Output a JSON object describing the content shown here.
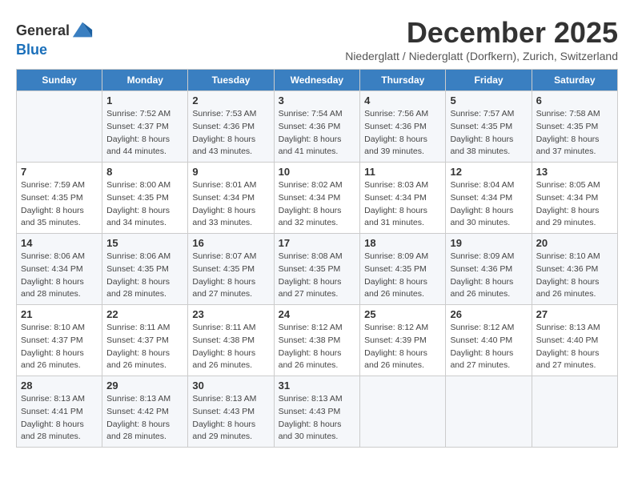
{
  "header": {
    "logo_general": "General",
    "logo_blue": "Blue",
    "title": "December 2025",
    "subtitle": "Niederglatt / Niederglatt (Dorfkern), Zurich, Switzerland"
  },
  "weekdays": [
    "Sunday",
    "Monday",
    "Tuesday",
    "Wednesday",
    "Thursday",
    "Friday",
    "Saturday"
  ],
  "weeks": [
    [
      {
        "day": "",
        "sunrise": "",
        "sunset": "",
        "daylight": ""
      },
      {
        "day": "1",
        "sunrise": "Sunrise: 7:52 AM",
        "sunset": "Sunset: 4:37 PM",
        "daylight": "Daylight: 8 hours and 44 minutes."
      },
      {
        "day": "2",
        "sunrise": "Sunrise: 7:53 AM",
        "sunset": "Sunset: 4:36 PM",
        "daylight": "Daylight: 8 hours and 43 minutes."
      },
      {
        "day": "3",
        "sunrise": "Sunrise: 7:54 AM",
        "sunset": "Sunset: 4:36 PM",
        "daylight": "Daylight: 8 hours and 41 minutes."
      },
      {
        "day": "4",
        "sunrise": "Sunrise: 7:56 AM",
        "sunset": "Sunset: 4:36 PM",
        "daylight": "Daylight: 8 hours and 39 minutes."
      },
      {
        "day": "5",
        "sunrise": "Sunrise: 7:57 AM",
        "sunset": "Sunset: 4:35 PM",
        "daylight": "Daylight: 8 hours and 38 minutes."
      },
      {
        "day": "6",
        "sunrise": "Sunrise: 7:58 AM",
        "sunset": "Sunset: 4:35 PM",
        "daylight": "Daylight: 8 hours and 37 minutes."
      }
    ],
    [
      {
        "day": "7",
        "sunrise": "Sunrise: 7:59 AM",
        "sunset": "Sunset: 4:35 PM",
        "daylight": "Daylight: 8 hours and 35 minutes."
      },
      {
        "day": "8",
        "sunrise": "Sunrise: 8:00 AM",
        "sunset": "Sunset: 4:35 PM",
        "daylight": "Daylight: 8 hours and 34 minutes."
      },
      {
        "day": "9",
        "sunrise": "Sunrise: 8:01 AM",
        "sunset": "Sunset: 4:34 PM",
        "daylight": "Daylight: 8 hours and 33 minutes."
      },
      {
        "day": "10",
        "sunrise": "Sunrise: 8:02 AM",
        "sunset": "Sunset: 4:34 PM",
        "daylight": "Daylight: 8 hours and 32 minutes."
      },
      {
        "day": "11",
        "sunrise": "Sunrise: 8:03 AM",
        "sunset": "Sunset: 4:34 PM",
        "daylight": "Daylight: 8 hours and 31 minutes."
      },
      {
        "day": "12",
        "sunrise": "Sunrise: 8:04 AM",
        "sunset": "Sunset: 4:34 PM",
        "daylight": "Daylight: 8 hours and 30 minutes."
      },
      {
        "day": "13",
        "sunrise": "Sunrise: 8:05 AM",
        "sunset": "Sunset: 4:34 PM",
        "daylight": "Daylight: 8 hours and 29 minutes."
      }
    ],
    [
      {
        "day": "14",
        "sunrise": "Sunrise: 8:06 AM",
        "sunset": "Sunset: 4:34 PM",
        "daylight": "Daylight: 8 hours and 28 minutes."
      },
      {
        "day": "15",
        "sunrise": "Sunrise: 8:06 AM",
        "sunset": "Sunset: 4:35 PM",
        "daylight": "Daylight: 8 hours and 28 minutes."
      },
      {
        "day": "16",
        "sunrise": "Sunrise: 8:07 AM",
        "sunset": "Sunset: 4:35 PM",
        "daylight": "Daylight: 8 hours and 27 minutes."
      },
      {
        "day": "17",
        "sunrise": "Sunrise: 8:08 AM",
        "sunset": "Sunset: 4:35 PM",
        "daylight": "Daylight: 8 hours and 27 minutes."
      },
      {
        "day": "18",
        "sunrise": "Sunrise: 8:09 AM",
        "sunset": "Sunset: 4:35 PM",
        "daylight": "Daylight: 8 hours and 26 minutes."
      },
      {
        "day": "19",
        "sunrise": "Sunrise: 8:09 AM",
        "sunset": "Sunset: 4:36 PM",
        "daylight": "Daylight: 8 hours and 26 minutes."
      },
      {
        "day": "20",
        "sunrise": "Sunrise: 8:10 AM",
        "sunset": "Sunset: 4:36 PM",
        "daylight": "Daylight: 8 hours and 26 minutes."
      }
    ],
    [
      {
        "day": "21",
        "sunrise": "Sunrise: 8:10 AM",
        "sunset": "Sunset: 4:37 PM",
        "daylight": "Daylight: 8 hours and 26 minutes."
      },
      {
        "day": "22",
        "sunrise": "Sunrise: 8:11 AM",
        "sunset": "Sunset: 4:37 PM",
        "daylight": "Daylight: 8 hours and 26 minutes."
      },
      {
        "day": "23",
        "sunrise": "Sunrise: 8:11 AM",
        "sunset": "Sunset: 4:38 PM",
        "daylight": "Daylight: 8 hours and 26 minutes."
      },
      {
        "day": "24",
        "sunrise": "Sunrise: 8:12 AM",
        "sunset": "Sunset: 4:38 PM",
        "daylight": "Daylight: 8 hours and 26 minutes."
      },
      {
        "day": "25",
        "sunrise": "Sunrise: 8:12 AM",
        "sunset": "Sunset: 4:39 PM",
        "daylight": "Daylight: 8 hours and 26 minutes."
      },
      {
        "day": "26",
        "sunrise": "Sunrise: 8:12 AM",
        "sunset": "Sunset: 4:40 PM",
        "daylight": "Daylight: 8 hours and 27 minutes."
      },
      {
        "day": "27",
        "sunrise": "Sunrise: 8:13 AM",
        "sunset": "Sunset: 4:40 PM",
        "daylight": "Daylight: 8 hours and 27 minutes."
      }
    ],
    [
      {
        "day": "28",
        "sunrise": "Sunrise: 8:13 AM",
        "sunset": "Sunset: 4:41 PM",
        "daylight": "Daylight: 8 hours and 28 minutes."
      },
      {
        "day": "29",
        "sunrise": "Sunrise: 8:13 AM",
        "sunset": "Sunset: 4:42 PM",
        "daylight": "Daylight: 8 hours and 28 minutes."
      },
      {
        "day": "30",
        "sunrise": "Sunrise: 8:13 AM",
        "sunset": "Sunset: 4:43 PM",
        "daylight": "Daylight: 8 hours and 29 minutes."
      },
      {
        "day": "31",
        "sunrise": "Sunrise: 8:13 AM",
        "sunset": "Sunset: 4:43 PM",
        "daylight": "Daylight: 8 hours and 30 minutes."
      },
      {
        "day": "",
        "sunrise": "",
        "sunset": "",
        "daylight": ""
      },
      {
        "day": "",
        "sunrise": "",
        "sunset": "",
        "daylight": ""
      },
      {
        "day": "",
        "sunrise": "",
        "sunset": "",
        "daylight": ""
      }
    ]
  ]
}
